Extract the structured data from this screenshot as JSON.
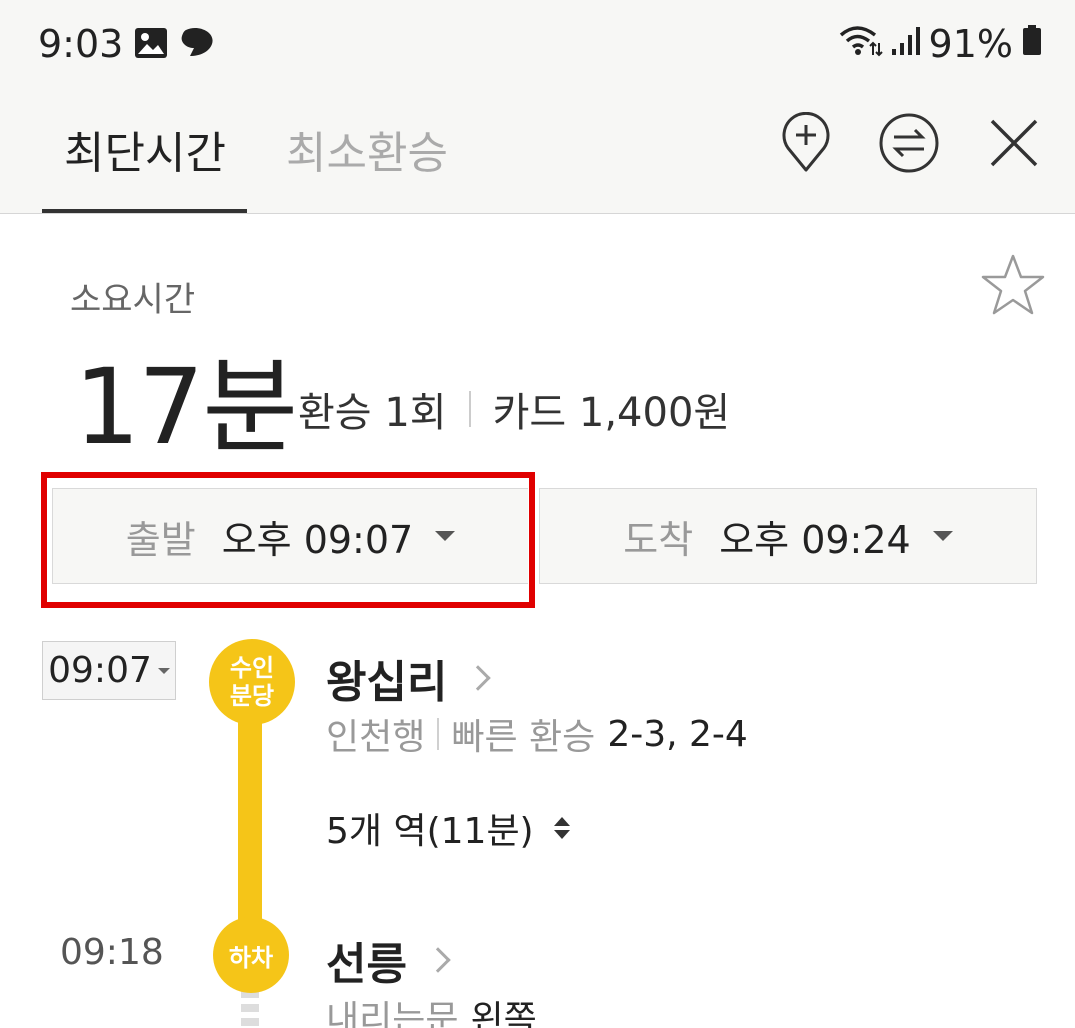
{
  "status_bar": {
    "time": "9:03",
    "battery": "91%",
    "icons": [
      "gallery-icon",
      "messenger-icon",
      "wifi-icon",
      "signal-icon",
      "battery-icon"
    ]
  },
  "header": {
    "tabs": [
      {
        "label": "최단시간",
        "active": true
      },
      {
        "label": "최소환승",
        "active": false
      }
    ],
    "actions": [
      "add-location-icon",
      "swap-icon",
      "close-icon"
    ]
  },
  "summary": {
    "duration_label": "소요시간",
    "duration_value": "17분",
    "transfers": "환승 1회",
    "fare": "카드 1,400원"
  },
  "times": {
    "departure_label": "출발",
    "departure_value": "오후 09:07",
    "arrival_label": "도착",
    "arrival_value": "오후 09:24"
  },
  "route": {
    "start_time": "09:07",
    "start_badge_line1": "수인",
    "start_badge_line2": "분당",
    "start_station": "왕십리",
    "direction": "인천행",
    "fast_transfer_label": "빠른 환승",
    "fast_transfer_value": "2-3, 2-4",
    "stops": "5개 역(11분)",
    "end_time": "09:18",
    "end_badge": "하차",
    "end_station": "선릉",
    "door_label": "내리는문",
    "door_value": "왼쪽"
  },
  "colors": {
    "line_yellow": "#f5c518",
    "highlight_red": "#e00000"
  }
}
